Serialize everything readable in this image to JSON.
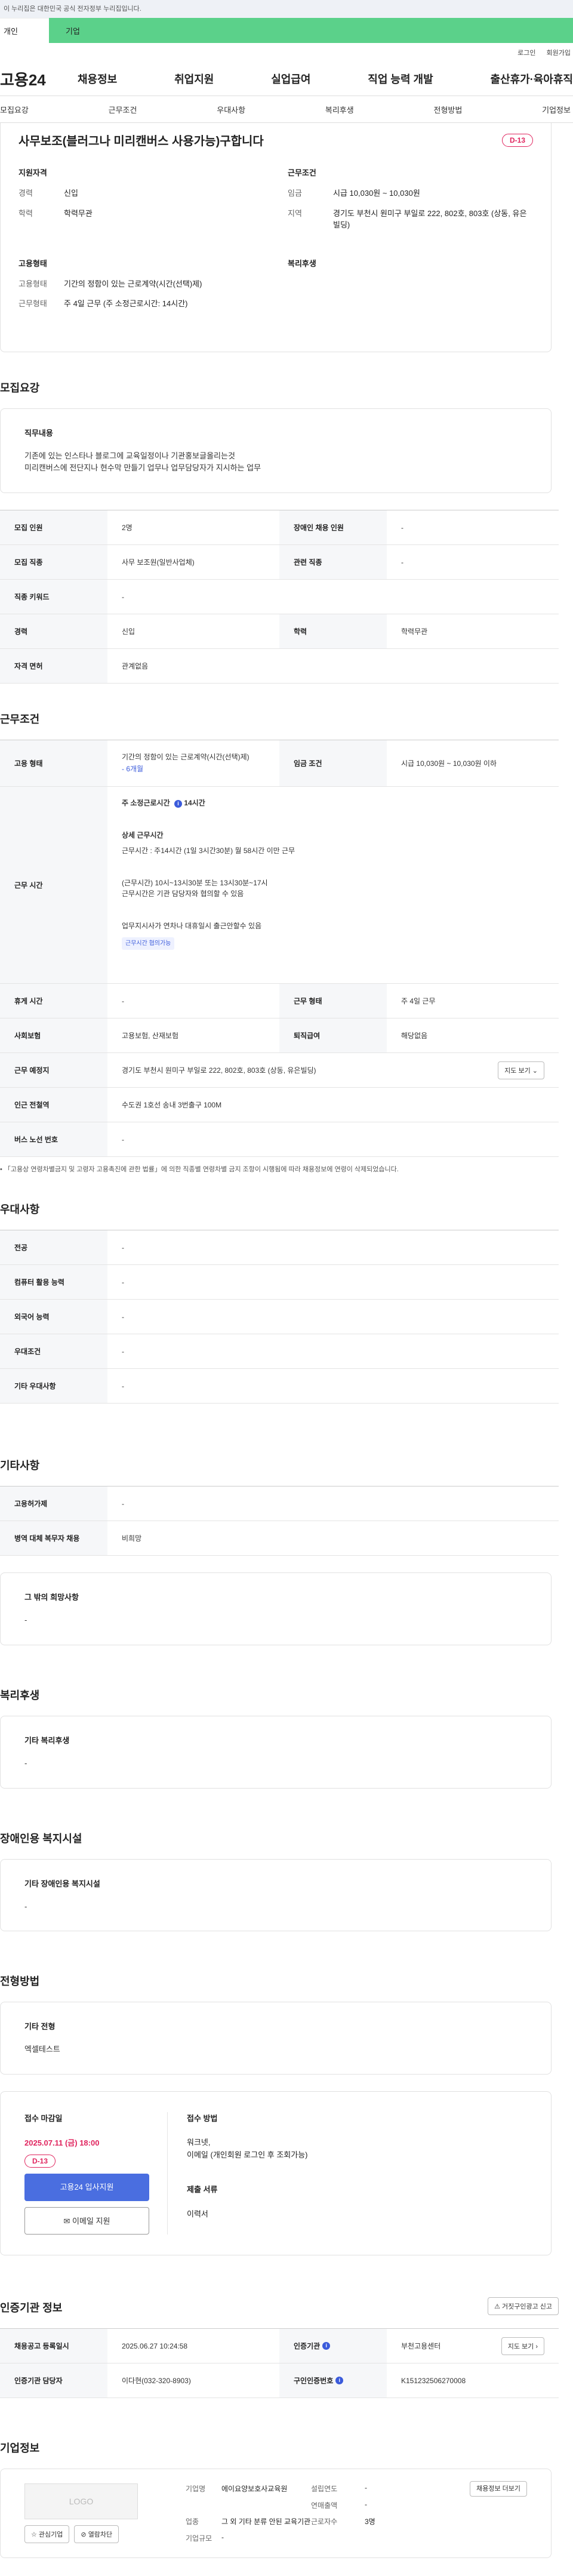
{
  "gov_notice": "이 누리집은 대한민국 공식 전자정부 누리집입니다.",
  "top_tabs": {
    "person": "개인",
    "company": "기업"
  },
  "util": {
    "login": "로그인",
    "join": "회원가입"
  },
  "brand": "고용24",
  "gnb": [
    "채용정보",
    "취업지원",
    "실업급여",
    "직업 능력 개발",
    "출산휴가·육아휴직"
  ],
  "lnb": [
    "모집요강",
    "근무조건",
    "우대사항",
    "복리후생",
    "전형방법",
    "기업정보"
  ],
  "job": {
    "title": "사무보조(블러그나 미리캔버스 사용가능)구합니다",
    "dday": "D-13",
    "qualification": {
      "heading": "지원자격",
      "career_k": "경력",
      "career_v": "신입",
      "edu_k": "학력",
      "edu_v": "학력무관"
    },
    "condition": {
      "heading": "근무조건",
      "wage_k": "임금",
      "wage_v": "시급 10,030원 ~ 10,030원",
      "region_k": "지역",
      "region_v": "경기도 부천시 원미구 부일로 222, 802호, 803호 (상동, 유은빌딩)"
    },
    "employment": {
      "heading": "고용형태",
      "type_k": "고용형태",
      "type_v": "기간의 정함이 있는 근로계약(시간(선택)제)",
      "work_k": "근무형태",
      "work_v": "주 4일 근무 (주 소정근로시간: 14시간)"
    },
    "welfare": {
      "heading": "복리후생"
    }
  },
  "recruit": {
    "title": "모집요강",
    "duty_heading": "직무내용",
    "duty_lines": [
      "기존에 있는 인스타나 블로그에 교육일정이나 기관홍보글올리는것",
      "미리캔버스에 전단지나 현수막 만들기 업무나 업무담당자가 지시하는 업무"
    ],
    "rows": [
      {
        "k1": "모집 인원",
        "v1": "2명",
        "k2": "장애인 채용 인원",
        "v2": "-"
      },
      {
        "k1": "모집 직종",
        "v1": "사무 보조원(일반사업체)",
        "k2": "관련 직종",
        "v2": "-"
      },
      {
        "k1": "직종 키워드",
        "v1": "-"
      },
      {
        "k1": "경력",
        "v1": "신입",
        "k2": "학력",
        "v2": "학력무관"
      },
      {
        "k1": "자격 면허",
        "v1": "관계없음"
      }
    ]
  },
  "work": {
    "title": "근무조건",
    "type_k": "고용 형태",
    "type_v": "기간의 정함이 있는 근로계약(시간(선택)제)",
    "type_period": "- 6개월",
    "wage_k": "임금 조건",
    "wage_v": "시급 10,030원 ~ 10,030원 이하",
    "hours_k": "근무 시간",
    "hours_week": "주 소정근로시간",
    "hours_week_v": "14시간",
    "hours_detail_title": "상세 근무시간",
    "hours_detail": "근무시간 : 주14시간 (1일 3시간30분) 월 58시간 이만 근무",
    "hours_l1": "(근무시간) 10시~13시30분 또는 13시30분~17시",
    "hours_l2": "근무시간은 기관 담당자와 협의할 수 있음",
    "hours_l3": "업무지시사가 연차나 대휴일시 출근안할수 있음",
    "hours_tag": "근무시간 협의가능",
    "rest_k": "휴게 시간",
    "rest_v": "-",
    "form_k": "근무 형태",
    "form_v": "주 4일 근무",
    "ins_k": "사회보험",
    "ins_v": "고용보험, 산재보험",
    "ret_k": "퇴직급여",
    "ret_v": "해당없음",
    "place_k": "근무 예정지",
    "place_v": "경기도 부천시 원미구 부일로 222, 802호, 803호 (상동, 유은빌딩)",
    "map_btn": "지도 보기",
    "subway_k": "인근 전철역",
    "subway_v": "수도권 1호선 송내 3번출구 100M",
    "bus_k": "버스 노선 번호",
    "bus_v": "-",
    "note": "「고용상 연령차별금지 및 고령자 고용촉진에 관한 법률」에 의한 직종별 연령차별 금지 조항이 시행됨에 따라 채용정보에 연령이 삭제되었습니다."
  },
  "prefer": {
    "title": "우대사항",
    "rows": [
      {
        "k": "전공",
        "v": "-"
      },
      {
        "k": "컴퓨터 활용 능력",
        "v": "-"
      },
      {
        "k": "외국어 능력",
        "v": "-"
      },
      {
        "k": "우대조건",
        "v": "-"
      },
      {
        "k": "기타 우대사항",
        "v": "-"
      }
    ]
  },
  "etc": {
    "title": "기타사항",
    "rows": [
      {
        "k": "고용허가제",
        "v": "-"
      },
      {
        "k": "병역 대체 복무자 채용",
        "v": "비희망"
      }
    ],
    "other_heading": "그 밖의 희망사항",
    "other_v": "-"
  },
  "welfare": {
    "title": "복리후생",
    "heading": "기타 복리후생",
    "v": "-"
  },
  "disabled": {
    "title": "장애인용 복지시설",
    "heading": "기타 장애인용 복지시설",
    "v": "-"
  },
  "screening": {
    "title": "전형방법",
    "heading": "기타 전형",
    "v": "엑셀테스트",
    "deadline_label": "접수 마감일",
    "deadline": "2025.07.11 (금) 18:00",
    "dday": "D-13",
    "apply_btn": "고용24 입사지원",
    "email_btn": "이메일 지원",
    "method_label": "접수 방법",
    "method_l1": "워크넷,",
    "method_l2": "이메일 (개인회원 로그인 후 조회가능)",
    "docs_label": "제출 서류",
    "docs_v": "이력서"
  },
  "agency": {
    "title": "인증기관 정보",
    "report_btn": "거짓구인광고 신고",
    "rows": [
      {
        "k1": "채용공고 등록일시",
        "v1": "2025.06.27 10:24:58",
        "k2": "인증기관",
        "v2": "부천고용센터",
        "btn": "지도 보기"
      },
      {
        "k1": "인증기관 담당자",
        "v1": "이다현(032-320-8903)",
        "k2": "구인인증번호",
        "v2": "K151232506270008"
      }
    ]
  },
  "company": {
    "title": "기업정보",
    "logo": "LOGO",
    "fav_btn": "관심기업",
    "block_btn": "열람차단",
    "name_k": "기업명",
    "name_v": "에이요양보호사교육원",
    "year_k": "설립연도",
    "year_v": "-",
    "sales_k": "연매출액",
    "sales_v": "-",
    "ind_k": "업종",
    "ind_v": "그 외 기타 분류 안된 교육기관",
    "emp_k": "근로자수",
    "emp_v": "3명",
    "size_k": "기업규모",
    "size_v": "-",
    "jobs_btn": "채용정보 더보기"
  }
}
